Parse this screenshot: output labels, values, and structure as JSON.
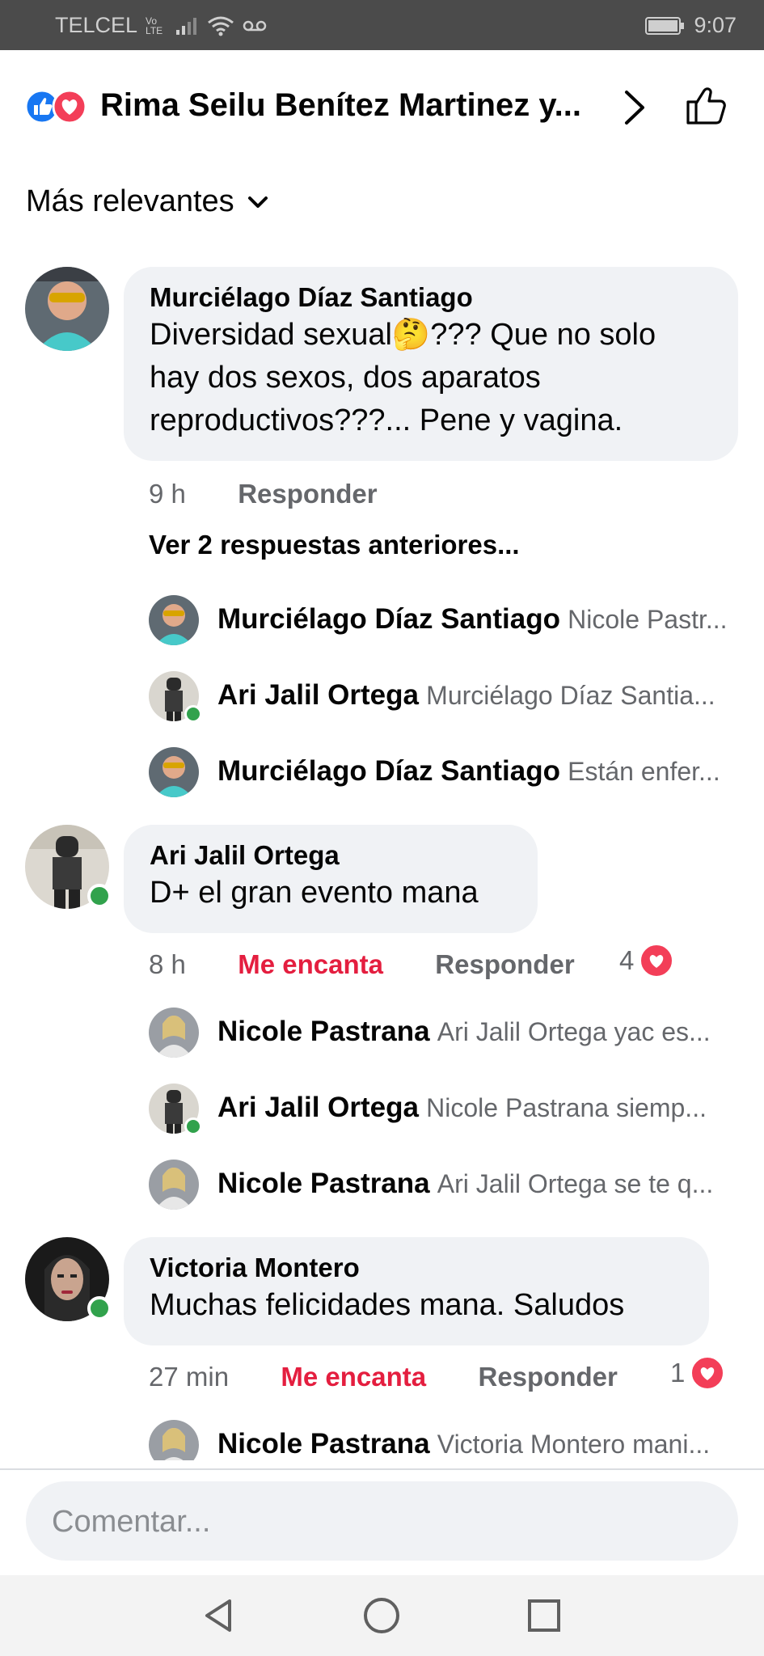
{
  "status_bar": {
    "carrier": "TELCEL",
    "network_badge": "Vo LTE",
    "time": "9:07"
  },
  "header": {
    "title": "Rima Seilu Benítez Martinez y...",
    "reaction_icons": [
      "like-icon",
      "love-icon"
    ]
  },
  "sort": {
    "label": "Más relevantes"
  },
  "comments": [
    {
      "author": "Murciélago Díaz Santiago",
      "text_before": "Diversidad sexual",
      "emoji": "🤔",
      "text_after": "??? Que no solo hay dos sexos, dos aparatos reproductivos???... Pene y vagina.",
      "time": "9 h",
      "love_label": "",
      "reply_label": "Responder",
      "reaction_count": "",
      "view_more": "Ver 2 respuestas anteriores...",
      "replies": [
        {
          "author": "Murciélago Díaz Santiago",
          "text": "Nicole Pastr..."
        },
        {
          "author": "Ari Jalil Ortega",
          "text": "Murciélago Díaz Santia..."
        },
        {
          "author": "Murciélago Díaz Santiago",
          "text": "Están enfer..."
        }
      ]
    },
    {
      "author": "Ari Jalil Ortega",
      "text": "D+ el gran evento mana",
      "time": "8 h",
      "love_label": "Me encanta",
      "reply_label": "Responder",
      "reaction_count": "4",
      "replies": [
        {
          "author": "Nicole Pastrana",
          "text": "Ari Jalil Ortega yac es..."
        },
        {
          "author": "Ari Jalil Ortega",
          "text": "Nicole Pastrana siemp..."
        },
        {
          "author": "Nicole Pastrana",
          "text": "Ari Jalil Ortega se te q..."
        }
      ]
    },
    {
      "author": "Victoria Montero",
      "text": "Muchas felicidades mana. Saludos",
      "time": "27 min",
      "love_label": "Me encanta",
      "reply_label": "Responder",
      "reaction_count": "1",
      "replies": [
        {
          "author": "Nicole Pastrana",
          "text": "Victoria Montero mani..."
        }
      ]
    }
  ],
  "composer": {
    "placeholder": "Comentar..."
  },
  "colors": {
    "facebook_blue": "#1877f2",
    "love_red": "#e41e3f",
    "bubble_gray": "#f0f2f5",
    "online_green": "#31a24c"
  },
  "nav_icons": [
    "back-icon",
    "home-icon",
    "recents-icon"
  ]
}
